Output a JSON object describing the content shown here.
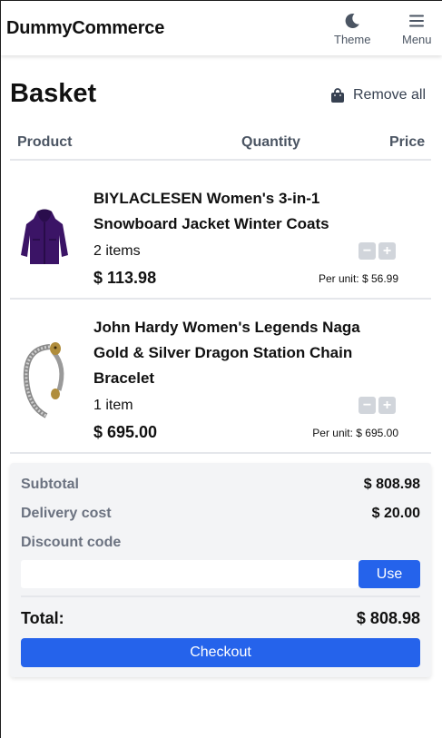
{
  "header": {
    "brand": "DummyCommerce",
    "theme_label": "Theme",
    "theme_icon": "moon-icon",
    "menu_label": "Menu",
    "menu_icon": "hamburger-icon"
  },
  "basket": {
    "title": "Basket",
    "remove_all_label": "Remove all",
    "remove_all_icon": "bag-icon",
    "columns": {
      "product": "Product",
      "quantity": "Quantity",
      "price": "Price"
    }
  },
  "items": [
    {
      "title": "BIYLACLESEN Women's 3-in-1 Snowboard Jacket Winter Coats",
      "quantity_text": "2 items",
      "total": "$ 113.98",
      "per_unit": "Per unit: $ 56.99",
      "image": "purple-jacket-image"
    },
    {
      "title": "John Hardy Women's Legends Naga Gold & Silver Dragon Station Chain Bracelet",
      "quantity_text": "1 item",
      "total": "$ 695.00",
      "per_unit": "Per unit: $ 695.00",
      "image": "dragon-bracelet-image"
    }
  ],
  "stepper": {
    "minus": "−",
    "plus": "+"
  },
  "summary": {
    "subtotal_label": "Subtotal",
    "subtotal_value": "$ 808.98",
    "delivery_label": "Delivery cost",
    "delivery_value": "$ 20.00",
    "discount_label": "Discount code",
    "discount_value": "",
    "discount_placeholder": "",
    "use_label": "Use",
    "total_label": "Total:",
    "total_value": "$ 808.98",
    "checkout_label": "Checkout"
  },
  "colors": {
    "accent": "#2563eb",
    "summary_bg": "#f3f4f6",
    "stepper_bg": "#d1d5db",
    "jacket": "#3b1466"
  }
}
